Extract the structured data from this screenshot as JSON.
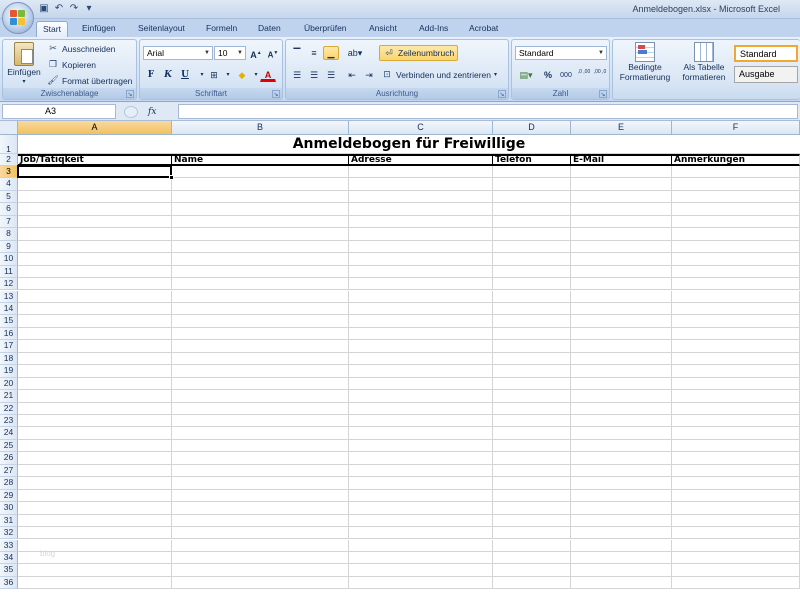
{
  "window": {
    "title": "Anmeldebogen.xlsx - Microsoft Excel"
  },
  "quick_access": {
    "icons": [
      "save-icon",
      "undo-icon",
      "redo-icon",
      "customize-icon"
    ]
  },
  "tabs": [
    {
      "label": "Start",
      "active": true
    },
    {
      "label": "Einfügen"
    },
    {
      "label": "Seitenlayout"
    },
    {
      "label": "Formeln"
    },
    {
      "label": "Daten"
    },
    {
      "label": "Überprüfen"
    },
    {
      "label": "Ansicht"
    },
    {
      "label": "Add-Ins"
    },
    {
      "label": "Acrobat"
    }
  ],
  "ribbon": {
    "clipboard": {
      "label": "Zwischenablage",
      "paste": "Einfügen",
      "cut": "Ausschneiden",
      "copy": "Kopieren",
      "format_painter": "Format übertragen"
    },
    "font": {
      "label": "Schriftart",
      "font_name": "Arial",
      "font_size": "10",
      "bold": "F",
      "italic": "K",
      "underline": "U"
    },
    "alignment": {
      "label": "Ausrichtung",
      "wrap_text": "Zeilenumbruch",
      "merge_center": "Verbinden und zentrieren"
    },
    "number": {
      "label": "Zahl",
      "format": "Standard",
      "percent": "%",
      "thousands": "000",
      "inc_decimal": ",0 ,00",
      "dec_decimal": ",00 ,0"
    },
    "styles": {
      "conditional_line1": "Bedingte",
      "conditional_line2": "Formatierung",
      "table_line1": "Als Tabelle",
      "table_line2": "formatieren",
      "style_standard": "Standard",
      "style_output": "Ausgabe"
    }
  },
  "formula_bar": {
    "name_box": "A3",
    "fx": "fx",
    "value": ""
  },
  "sheet": {
    "columns": [
      "A",
      "B",
      "C",
      "D",
      "E",
      "F"
    ],
    "selected_column": "A",
    "selected_row": 3,
    "title": "Anmeldebogen für Freiwillige",
    "headers": [
      "Job/Tätiqkeit",
      "Name",
      "Adresse",
      "Telefon",
      "E-Mail",
      "Anmerkungen"
    ],
    "row_count": 36,
    "active_cell": "A3"
  },
  "watermark": "blog"
}
